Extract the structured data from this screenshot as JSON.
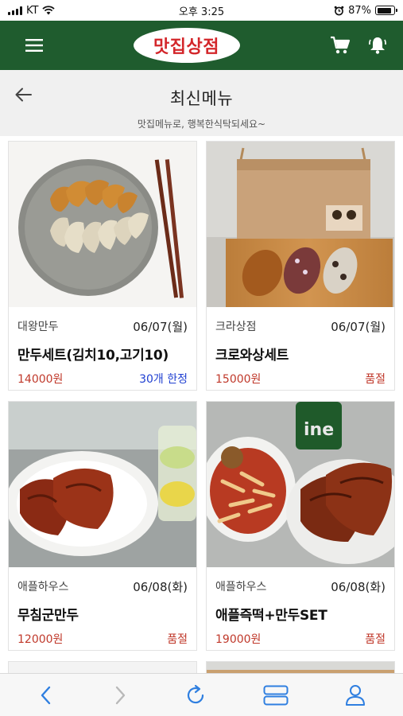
{
  "status_bar": {
    "carrier": "KT",
    "time": "오후 3:25",
    "battery": "87%",
    "battery_level": 0.87
  },
  "header": {
    "logo_text": "맛집상점"
  },
  "page": {
    "title": "최신메뉴",
    "subtitle": "맛집메뉴로, 행복한식탁되세요~"
  },
  "items": [
    {
      "store": "대왕만두",
      "date": "06/07(월)",
      "name": "만두세트(김치10,고기10)",
      "price": "14000원",
      "status": "30개 한정",
      "status_type": "limit"
    },
    {
      "store": "크라상점",
      "date": "06/07(월)",
      "name": "크로와상세트",
      "price": "15000원",
      "status": "품절",
      "status_type": "sold"
    },
    {
      "store": "애플하우스",
      "date": "06/08(화)",
      "name": "무침군만두",
      "price": "12000원",
      "status": "품절",
      "status_type": "sold"
    },
    {
      "store": "애플하우스",
      "date": "06/08(화)",
      "name": "애플즉떡+만두SET",
      "price": "19000원",
      "status": "품절",
      "status_type": "sold"
    }
  ],
  "colors": {
    "brand_green": "#1f5c2e",
    "logo_red": "#d3262a",
    "price_red": "#c0392b",
    "limit_blue": "#1f3fd1",
    "browser_blue": "#2f7fe0"
  },
  "icons": {
    "menu": "hamburger-icon",
    "cart": "cart-icon",
    "bell": "bell-icon",
    "back": "arrow-left-icon",
    "browser": [
      "chevron-left-icon",
      "chevron-right-icon",
      "reload-icon",
      "tabs-icon",
      "account-icon"
    ]
  }
}
